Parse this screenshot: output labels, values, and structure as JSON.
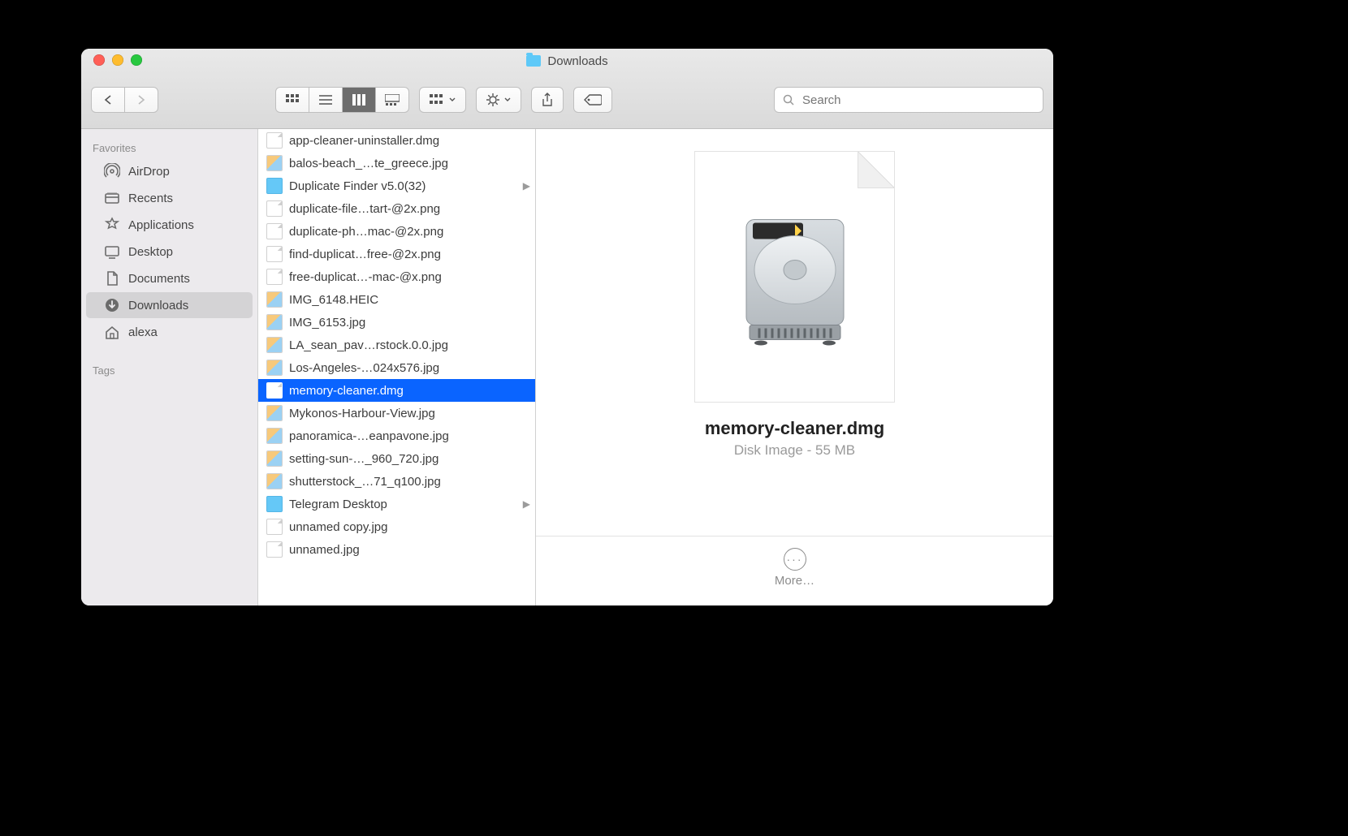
{
  "window": {
    "title": "Downloads"
  },
  "toolbar": {
    "search_placeholder": "Search"
  },
  "sidebar": {
    "heading": "Favorites",
    "tags_heading": "Tags",
    "items": [
      {
        "label": "AirDrop",
        "sel": false
      },
      {
        "label": "Recents",
        "sel": false
      },
      {
        "label": "Applications",
        "sel": false
      },
      {
        "label": "Desktop",
        "sel": false
      },
      {
        "label": "Documents",
        "sel": false
      },
      {
        "label": "Downloads",
        "sel": true
      },
      {
        "label": "alexa",
        "sel": false
      }
    ]
  },
  "files": [
    {
      "name": "app-cleaner-uninstaller.dmg",
      "type": "doc",
      "sel": false,
      "folder": false
    },
    {
      "name": "balos-beach_…te_greece.jpg",
      "type": "img",
      "sel": false,
      "folder": false
    },
    {
      "name": "Duplicate Finder v5.0(32)",
      "type": "folder",
      "sel": false,
      "folder": true
    },
    {
      "name": "duplicate-file…tart-@2x.png",
      "type": "doc",
      "sel": false,
      "folder": false
    },
    {
      "name": "duplicate-ph…mac-@2x.png",
      "type": "doc",
      "sel": false,
      "folder": false
    },
    {
      "name": "find-duplicat…free-@2x.png",
      "type": "doc",
      "sel": false,
      "folder": false
    },
    {
      "name": "free-duplicat…-mac-@x.png",
      "type": "doc",
      "sel": false,
      "folder": false
    },
    {
      "name": "IMG_6148.HEIC",
      "type": "img",
      "sel": false,
      "folder": false
    },
    {
      "name": "IMG_6153.jpg",
      "type": "img",
      "sel": false,
      "folder": false
    },
    {
      "name": "LA_sean_pav…rstock.0.0.jpg",
      "type": "img",
      "sel": false,
      "folder": false
    },
    {
      "name": "Los-Angeles-…024x576.jpg",
      "type": "img",
      "sel": false,
      "folder": false
    },
    {
      "name": "memory-cleaner.dmg",
      "type": "doc",
      "sel": true,
      "folder": false
    },
    {
      "name": "Mykonos-Harbour-View.jpg",
      "type": "img",
      "sel": false,
      "folder": false
    },
    {
      "name": "panoramica-…eanpavone.jpg",
      "type": "img",
      "sel": false,
      "folder": false
    },
    {
      "name": "setting-sun-…_960_720.jpg",
      "type": "img",
      "sel": false,
      "folder": false
    },
    {
      "name": "shutterstock_…71_q100.jpg",
      "type": "img",
      "sel": false,
      "folder": false
    },
    {
      "name": "Telegram Desktop",
      "type": "folder",
      "sel": false,
      "folder": true
    },
    {
      "name": "unnamed copy.jpg",
      "type": "doc",
      "sel": false,
      "folder": false
    },
    {
      "name": "unnamed.jpg",
      "type": "doc",
      "sel": false,
      "folder": false
    }
  ],
  "preview": {
    "filename": "memory-cleaner.dmg",
    "kind": "Disk Image - 55 MB",
    "more_label": "More…"
  }
}
